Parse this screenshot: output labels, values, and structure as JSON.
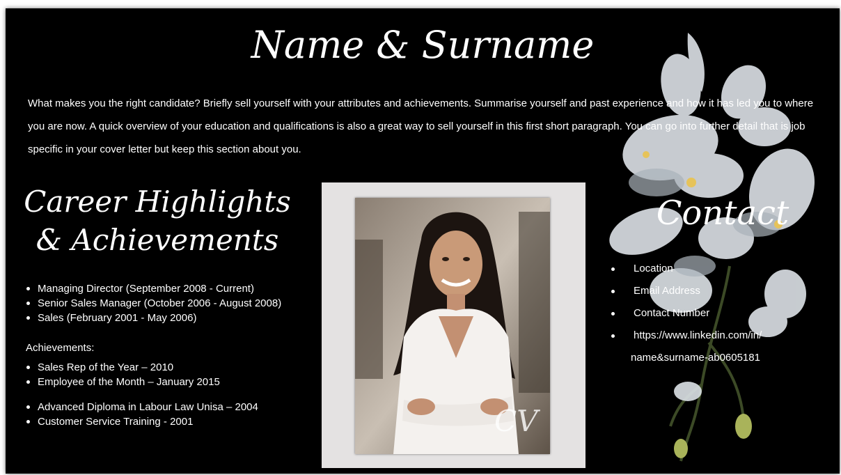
{
  "header": {
    "name": "Name & Surname"
  },
  "summary": "What makes you the right candidate? Briefly sell yourself with your attributes and achievements. Summarise yourself and past experience and how it has led you to where you are now. A quick overview of your education and qualifications is also a great way to sell yourself in this first short paragraph. You can go into further detail that is job specific in your cover letter but keep this section about you.",
  "career": {
    "heading_line1": "Career Highlights",
    "heading_line2": "& Achievements",
    "roles": [
      "Managing Director (September 2008 - Current)",
      "Senior Sales Manager (October 2006 - August 2008)",
      "Sales (February 2001 - May 2006)"
    ],
    "achievements_label": "Achievements:",
    "achievements": [
      "Sales Rep of the Year – 2010",
      "Employee of the Month – January 2015"
    ],
    "training": [
      "Advanced Diploma in Labour Law Unisa – 2004",
      "Customer Service Training - 2001"
    ]
  },
  "photo": {
    "icon": "portrait-photo"
  },
  "contact": {
    "heading": "Contact",
    "items": [
      "Location",
      "Email Address",
      "Contact Number"
    ],
    "linkedin_line1": "https://www.linkedin.com/in/",
    "linkedin_line2": "name&surname-ab0605181"
  },
  "colors": {
    "background": "#000000",
    "text": "#ffffff",
    "photo_frame": "#e4e2e2"
  }
}
